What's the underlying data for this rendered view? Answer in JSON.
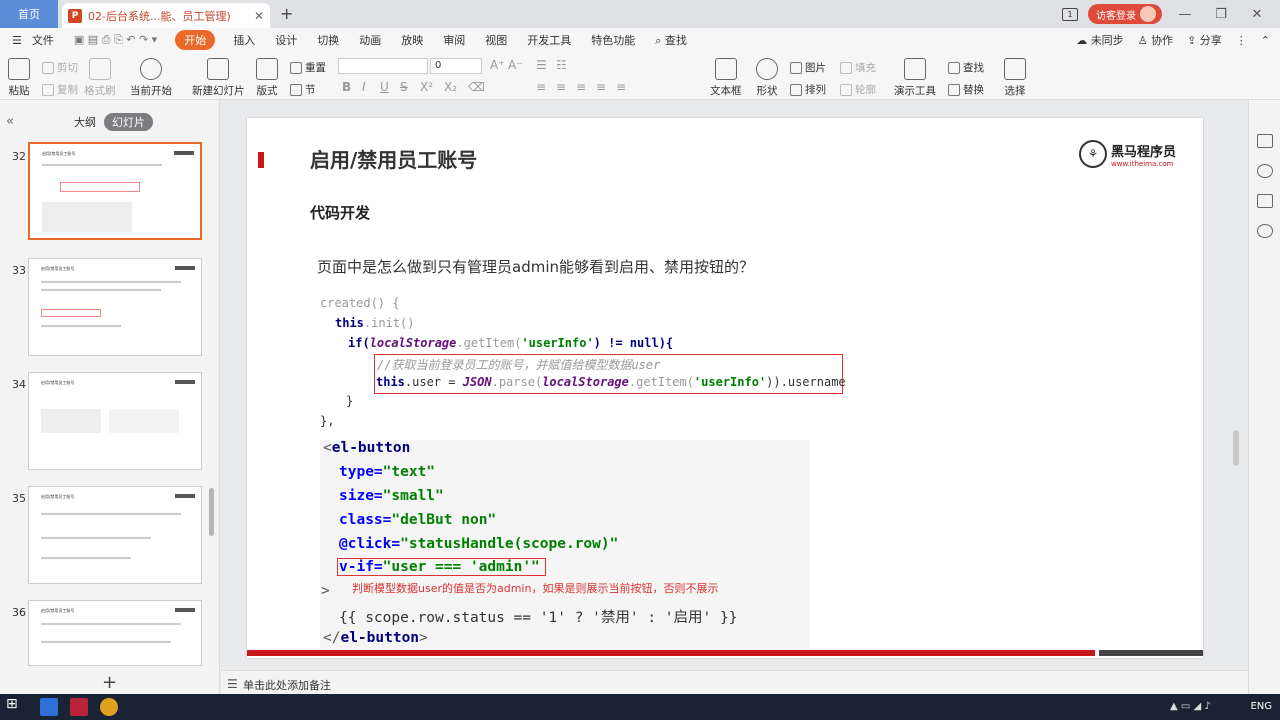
{
  "titlebar": {
    "home_tab": "首页",
    "doc_tab": "02-后台系统...能、员工管理)",
    "guest_label": "访客登录",
    "badge_num": "1"
  },
  "menu": {
    "items": [
      "文件",
      "开始",
      "插入",
      "设计",
      "切换",
      "动画",
      "放映",
      "审阅",
      "视图",
      "开发工具",
      "特色功能",
      "查找"
    ],
    "active": "开始",
    "sync": "未同步",
    "collab": "协作",
    "share": "分享"
  },
  "ribbon": {
    "paste": "粘贴",
    "cut": "剪切",
    "copy": "复制",
    "format_painter": "格式刷",
    "from_current": "当前开始",
    "new_slide": "新建幻灯片",
    "layout": "版式",
    "section": "节",
    "reset": "重置",
    "font_size": "0",
    "textbox": "文本框",
    "shape": "形状",
    "arrange": "排列",
    "picture": "图片",
    "fill": "填充",
    "outline": "轮廓",
    "present_tool": "演示工具",
    "find": "查找",
    "replace": "替换",
    "select": "选择"
  },
  "left_panel": {
    "tab_outline": "大纲",
    "tab_slides": "幻灯片",
    "slide_numbers": [
      "32",
      "33",
      "34",
      "35",
      "36"
    ],
    "thumb_title": "启用/禁用员工账号"
  },
  "slide": {
    "title": "启用/禁用员工账号",
    "logo_main": "黑马程序员",
    "logo_sub": "www.itheima.com",
    "subtitle": "代码开发",
    "question": "页面中是怎么做到只有管理员admin能够看到启用、禁用按钮的？",
    "code1": {
      "l1": "created() {",
      "l2_kw": "this",
      "l2_fn": ".init()",
      "l3_a": "if(",
      "l3_b": "localStorage",
      "l3_c": ".getItem(",
      "l3_d": "'userInfo'",
      "l3_e": ") != null){",
      "l4": "//获取当前登录员工的账号，并赋值给模型数据user",
      "l5_a": "this",
      "l5_b": ".user = ",
      "l5_c": "JSON",
      "l5_d": ".parse(",
      "l5_e": "localStorage",
      "l5_f": ".getItem(",
      "l5_g": "'userInfo'",
      "l5_h": ")).username",
      "l6": "}",
      "l7": "},"
    },
    "code2": {
      "open_tag": "el-button",
      "attr1": "type=",
      "val1": "\"text\"",
      "attr2": "size=",
      "val2": "\"small\"",
      "attr3": "class=",
      "val3": "\"delBut non\"",
      "attr4": "@click=",
      "val4": "\"statusHandle(scope.row)\"",
      "attr5": "v-if=",
      "val5": "\"user === 'admin'\"",
      "gt": ">",
      "expr": "{{ scope.row.status == '1' ? '禁用' : '启用' }}",
      "close_tag": "el-button"
    },
    "note": "判断模型数据user的值是否为admin，如果是则展示当前按钮，否则不展示"
  },
  "notes": {
    "placeholder": "单击此处添加备注"
  },
  "taskbar": {
    "lang": "ENG"
  }
}
